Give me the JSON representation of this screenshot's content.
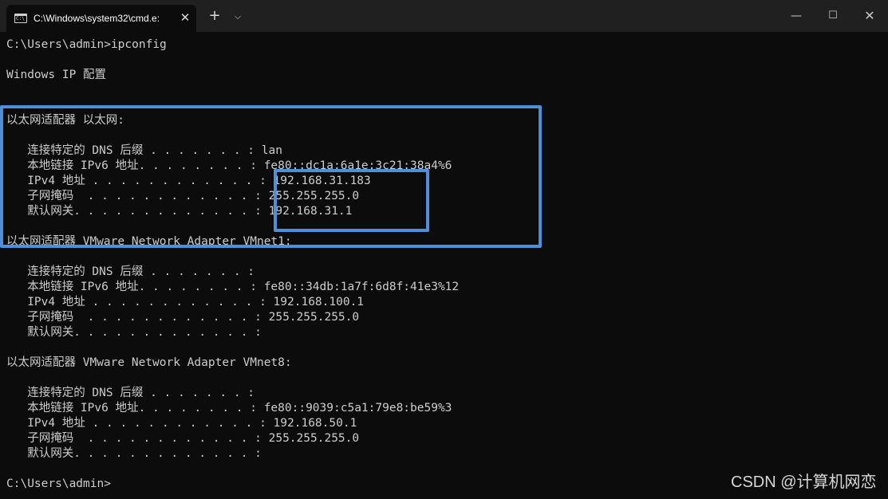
{
  "tab": {
    "title": "C:\\Windows\\system32\\cmd.e:",
    "close": "✕",
    "new_tab": "+",
    "dropdown": "⌵"
  },
  "window_controls": {
    "minimize": "—",
    "maximize": "☐",
    "close": "✕"
  },
  "terminal": {
    "lines": [
      "C:\\Users\\admin>ipconfig",
      "",
      "Windows IP 配置",
      "",
      "",
      "以太网适配器 以太网:",
      "",
      "   连接特定的 DNS 后缀 . . . . . . . : lan",
      "   本地链接 IPv6 地址. . . . . . . . : fe80::dc1a:6a1e:3c21:38a4%6",
      "   IPv4 地址 . . . . . . . . . . . . : 192.168.31.183",
      "   子网掩码  . . . . . . . . . . . . : 255.255.255.0",
      "   默认网关. . . . . . . . . . . . . : 192.168.31.1",
      "",
      "以太网适配器 VMware Network Adapter VMnet1:",
      "",
      "   连接特定的 DNS 后缀 . . . . . . . :",
      "   本地链接 IPv6 地址. . . . . . . . : fe80::34db:1a7f:6d8f:41e3%12",
      "   IPv4 地址 . . . . . . . . . . . . : 192.168.100.1",
      "   子网掩码  . . . . . . . . . . . . : 255.255.255.0",
      "   默认网关. . . . . . . . . . . . . :",
      "",
      "以太网适配器 VMware Network Adapter VMnet8:",
      "",
      "   连接特定的 DNS 后缀 . . . . . . . :",
      "   本地链接 IPv6 地址. . . . . . . . : fe80::9039:c5a1:79e8:be59%3",
      "   IPv4 地址 . . . . . . . . . . . . : 192.168.50.1",
      "   子网掩码  . . . . . . . . . . . . : 255.255.255.0",
      "   默认网关. . . . . . . . . . . . . :",
      "",
      "C:\\Users\\admin>"
    ]
  },
  "watermark": "CSDN @计算机网恋",
  "colors": {
    "background": "#0c0c0c",
    "text": "#cccccc",
    "highlight": "#4f8ed8",
    "titlebar": "#202020"
  }
}
